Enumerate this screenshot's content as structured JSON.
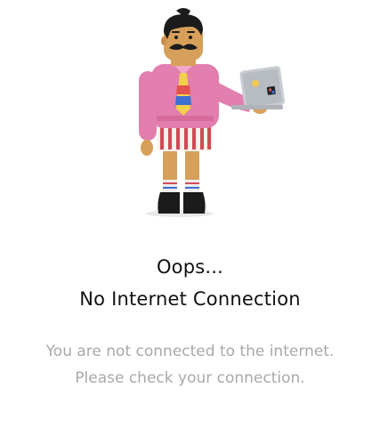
{
  "error_screen": {
    "title_line1": "Oops...",
    "title_line2": "No Internet Connection",
    "message_line1": "You are not connected to the internet.",
    "message_line2": "Please check your connection.",
    "illustration": "man-with-laptop-illustration"
  },
  "colors": {
    "background": "#ffffff",
    "title": "#111111",
    "message": "#a8a8a8",
    "shirt": "#e27fae",
    "laptop": "#c9ccd1"
  }
}
